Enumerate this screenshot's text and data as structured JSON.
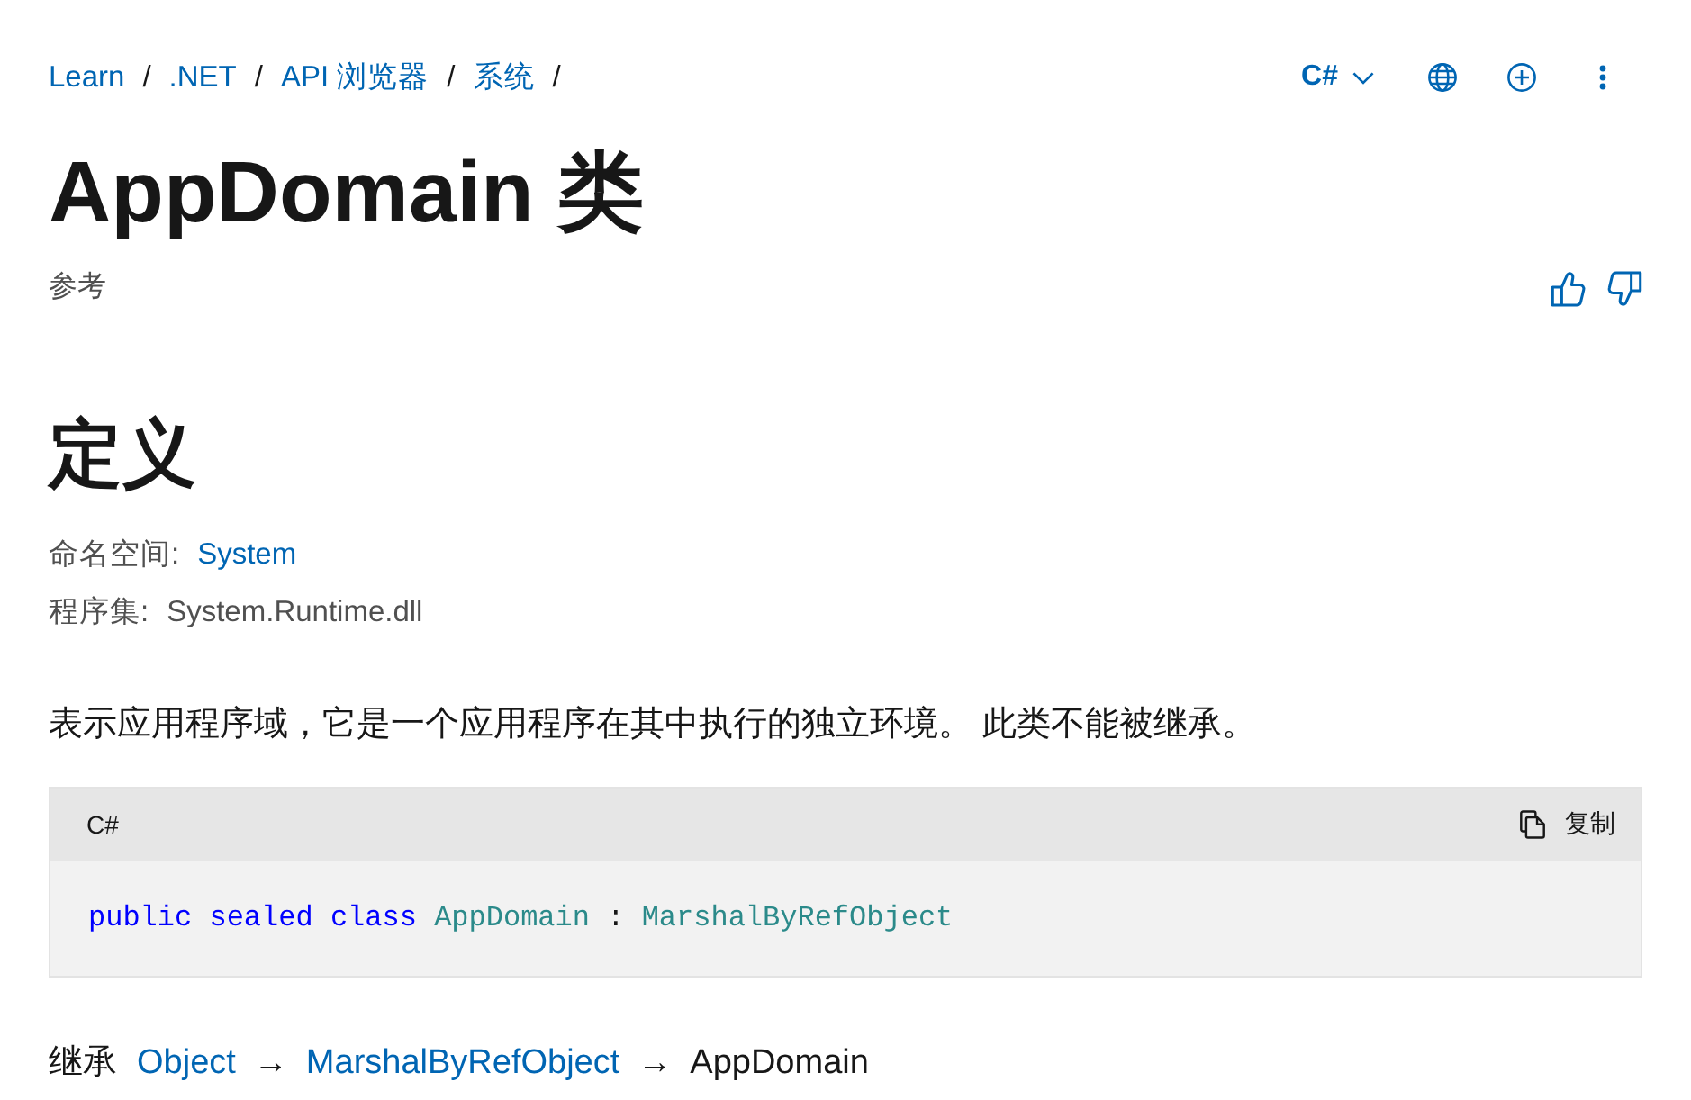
{
  "breadcrumb": [
    {
      "label": "Learn",
      "separator": "/"
    },
    {
      "label": ".NET",
      "separator": "/"
    },
    {
      "label": "API 浏览器",
      "separator": "/"
    },
    {
      "label": "系统",
      "separator": "/"
    }
  ],
  "toolbar": {
    "language": "C#"
  },
  "title": "AppDomain 类",
  "subtitle": "参考",
  "section_heading": "定义",
  "meta": [
    {
      "label": "命名空间:",
      "value": "System",
      "kind": "link"
    },
    {
      "label": "程序集:",
      "value": "System.Runtime.dll",
      "kind": "text"
    }
  ],
  "description": "表示应用程序域，它是一个应用程序在其中执行的独立环境。 此类不能被继承。",
  "code_block": {
    "language": "C#",
    "copy_label": "复制",
    "tokens": [
      {
        "text": "public",
        "kind": "keyword"
      },
      {
        "text": "sealed",
        "kind": "keyword"
      },
      {
        "text": "class",
        "kind": "keyword"
      },
      {
        "text": "AppDomain",
        "kind": "type"
      },
      {
        "text": ":",
        "kind": "punct"
      },
      {
        "text": "MarshalByRefObject",
        "kind": "type"
      }
    ]
  },
  "inheritance": {
    "label": "继承",
    "items": [
      {
        "text": "Object",
        "kind": "link"
      },
      {
        "text": "→",
        "kind": "arrow"
      },
      {
        "text": "MarshalByRefObject",
        "kind": "link"
      },
      {
        "text": "→",
        "kind": "arrow"
      },
      {
        "text": "AppDomain",
        "kind": "current"
      }
    ]
  }
}
